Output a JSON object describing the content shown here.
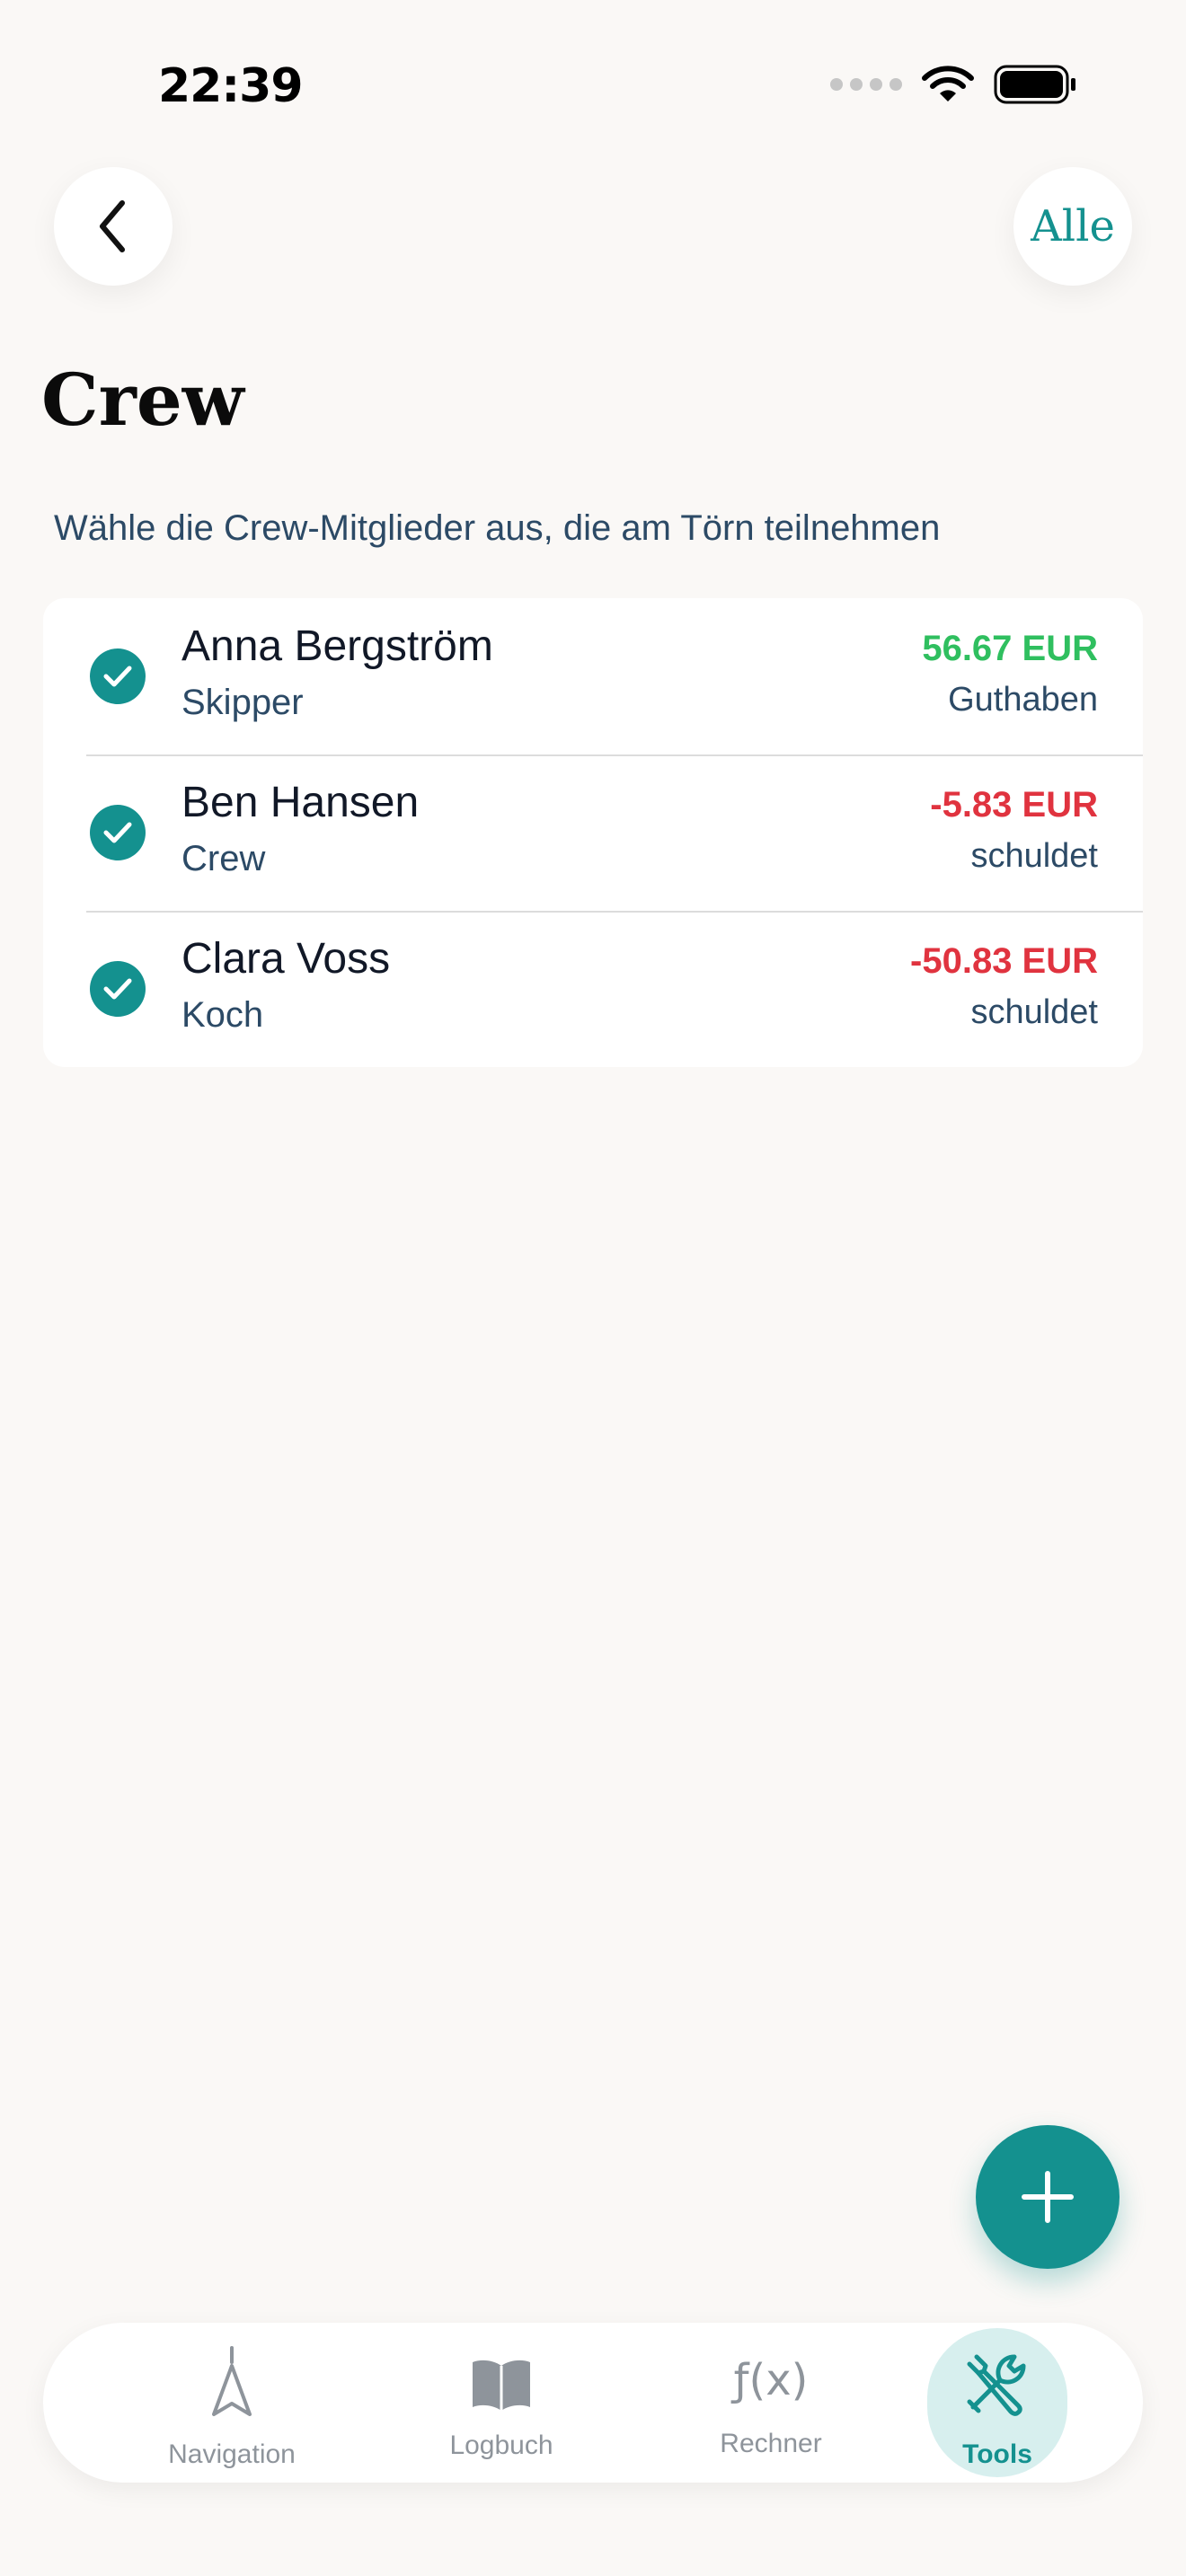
{
  "status_bar": {
    "time": "22:39"
  },
  "header": {
    "all_button_label": "Alle",
    "title": "Crew",
    "subtitle": "Wähle die Crew-Mitglieder aus, die am Törn teilnehmen"
  },
  "crew": [
    {
      "name": "Anna Bergström",
      "role": "Skipper",
      "amount": "56.67 EUR",
      "status": "Guthaben",
      "selected": true,
      "amount_color": "#2fbf5f"
    },
    {
      "name": "Ben Hansen",
      "role": "Crew",
      "amount": "-5.83 EUR",
      "status": "schuldet",
      "selected": true,
      "amount_color": "#e0333f"
    },
    {
      "name": "Clara Voss",
      "role": "Koch",
      "amount": "-50.83 EUR",
      "status": "schuldet",
      "selected": true,
      "amount_color": "#e0333f"
    }
  ],
  "tab_bar": {
    "items": [
      {
        "label": "Navigation",
        "icon": "navigation-arrow-icon",
        "active": false
      },
      {
        "label": "Logbuch",
        "icon": "book-icon",
        "active": false
      },
      {
        "label": "Rechner",
        "icon": "function-icon",
        "glyph": "ƒ(x)",
        "active": false
      },
      {
        "label": "Tools",
        "icon": "tools-icon",
        "active": true
      }
    ]
  },
  "colors": {
    "accent": "#14918f",
    "background": "#faf8f6",
    "positive": "#2fbf5f",
    "negative": "#e0333f"
  }
}
